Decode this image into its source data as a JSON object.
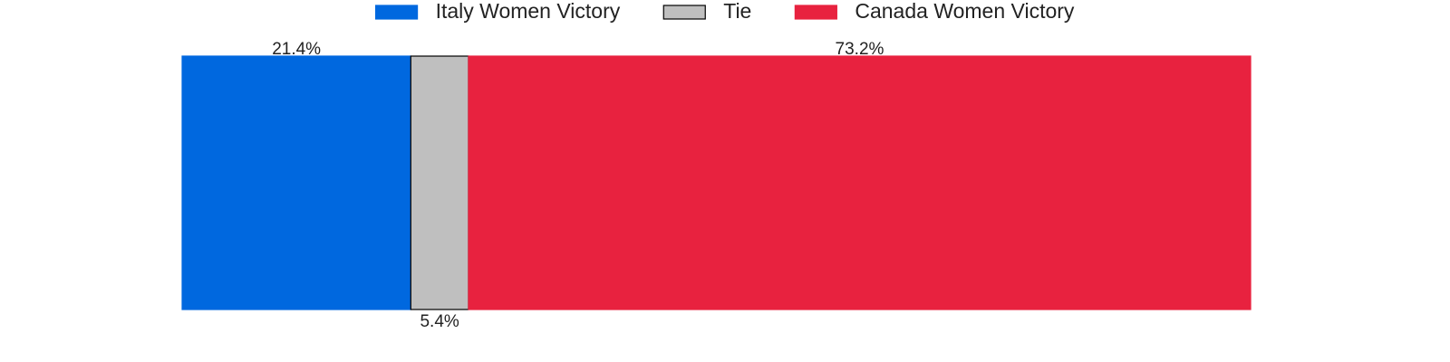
{
  "chart_data": {
    "type": "bar",
    "orientation": "horizontal",
    "stacked": true,
    "normalized": true,
    "title": "",
    "xlabel": "",
    "ylabel": "",
    "xlim": [
      0,
      100
    ],
    "grid": false,
    "axes_visible": false,
    "legend_position": "top-center",
    "categories": [
      ""
    ],
    "series": [
      {
        "name": "Italy Women Victory",
        "values": [
          21.4
        ],
        "label": "21.4%",
        "label_position": "above",
        "color": "#0068DF",
        "edge": "#0068DF"
      },
      {
        "name": "Tie",
        "values": [
          5.4
        ],
        "label": "5.4%",
        "label_position": "below",
        "color": "#BFBFBF",
        "edge": "#000000"
      },
      {
        "name": "Canada Women Victory",
        "values": [
          73.2
        ],
        "label": "73.2%",
        "label_position": "above",
        "color": "#E8223F",
        "edge": "#E8223F"
      }
    ]
  }
}
